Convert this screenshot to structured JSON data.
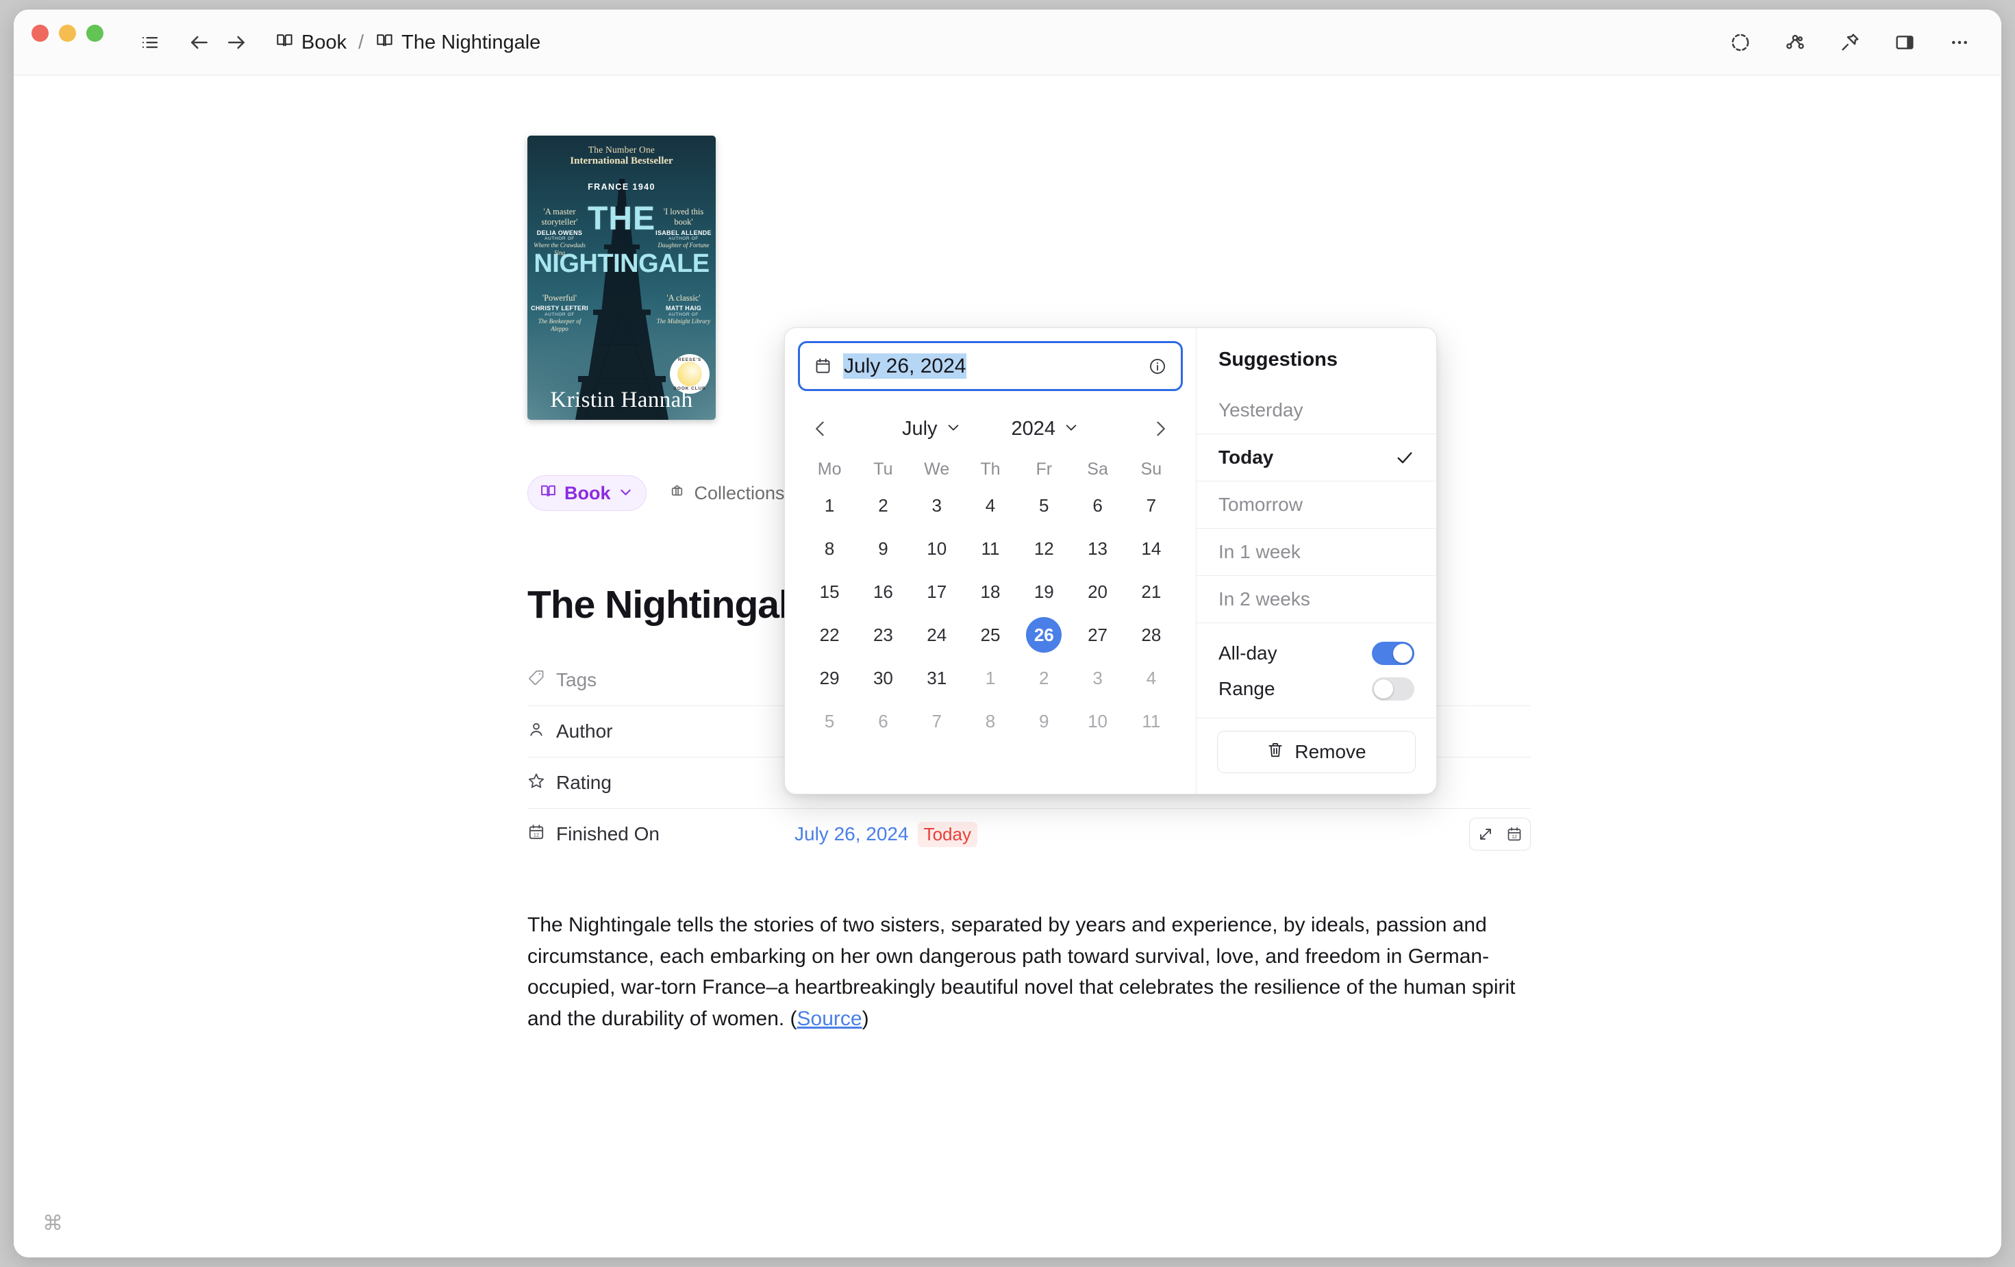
{
  "window": {
    "traffic_lights": [
      "close",
      "minimize",
      "maximize"
    ]
  },
  "toolbar": {
    "sidebar_toggle_icon": "list-icon",
    "back_icon": "arrow-left-icon",
    "forward_icon": "arrow-right-icon",
    "breadcrumb": {
      "parent_icon": "book-icon",
      "parent": "Book",
      "separator": "/",
      "current_icon": "book-icon",
      "current": "The Nightingale"
    },
    "right_actions": [
      {
        "name": "capture-icon",
        "label": ""
      },
      {
        "name": "graph-view-icon",
        "label": ""
      },
      {
        "name": "pin-icon",
        "label": ""
      },
      {
        "name": "panel-right-icon",
        "label": ""
      },
      {
        "name": "more-options-icon",
        "label": ""
      }
    ]
  },
  "cover": {
    "top_line_1": "The Number One",
    "top_line_2": "International Bestseller",
    "setting": "FRANCE 1940",
    "the": "THE",
    "title": "NIGHTINGALE",
    "author": "Kristin Hannah",
    "blurbs": [
      {
        "quote": "'A master storyteller'",
        "name": "DELIA OWENS",
        "author_of": "AUTHOR OF",
        "book": "Where the Crawdads Sing"
      },
      {
        "quote": "'I loved this book'",
        "name": "ISABEL ALLENDE",
        "author_of": "AUTHOR OF",
        "book": "Daughter of Fortune"
      },
      {
        "quote": "'Powerful'",
        "name": "CHRISTY LEFTERI",
        "author_of": "AUTHOR OF",
        "book": "The Beekeeper of Aleppo"
      },
      {
        "quote": "'A classic'",
        "name": "MATT HAIG",
        "author_of": "AUTHOR OF",
        "book": "The Midnight Library"
      }
    ],
    "badge_top": "REESE'S",
    "badge_bottom": "BOOK CLUB"
  },
  "page": {
    "type_chip": "Book",
    "collections_chip": "Collections",
    "title": "The Nightingale",
    "properties": [
      {
        "icon": "tag-icon",
        "label": "Tags",
        "muted": true,
        "value": ""
      },
      {
        "icon": "person-icon",
        "label": "Author",
        "muted": false,
        "value": ""
      },
      {
        "icon": "star-icon",
        "label": "Rating",
        "muted": false,
        "value": ""
      },
      {
        "icon": "calendar-icon",
        "label": "Finished On",
        "muted": false,
        "value": "July 26, 2024",
        "badge": "Today"
      }
    ],
    "row_actions": [
      {
        "name": "expand-icon"
      },
      {
        "name": "calendar-icon"
      }
    ],
    "body": {
      "text_before_link": "The Nightingale tells the stories of two sisters, separated by years and experience, by ideals, passion and circumstance, each embarking on her own dangerous path toward survival, love, and freedom in German-occupied, war-torn France–a heartbreakingly beautiful novel that celebrates the resilience of the human spirit and the durability of women. (",
      "link_text": "Source",
      "text_after_link": ")"
    },
    "command_key_glyph": "⌘"
  },
  "date_popover": {
    "input": {
      "icon": "calendar-icon",
      "value": "July 26, 2024",
      "selected": true,
      "info_icon": "info-icon"
    },
    "calendar": {
      "prev_icon": "chevron-left-icon",
      "next_icon": "chevron-right-icon",
      "month": "July",
      "year": "2024",
      "weekday_headers": [
        "Mo",
        "Tu",
        "We",
        "Th",
        "Fr",
        "Sa",
        "Su"
      ],
      "weeks": [
        [
          {
            "d": "1",
            "o": false
          },
          {
            "d": "2",
            "o": false
          },
          {
            "d": "3",
            "o": false
          },
          {
            "d": "4",
            "o": false
          },
          {
            "d": "5",
            "o": false
          },
          {
            "d": "6",
            "o": false
          },
          {
            "d": "7",
            "o": false
          }
        ],
        [
          {
            "d": "8",
            "o": false
          },
          {
            "d": "9",
            "o": false
          },
          {
            "d": "10",
            "o": false
          },
          {
            "d": "11",
            "o": false
          },
          {
            "d": "12",
            "o": false
          },
          {
            "d": "13",
            "o": false
          },
          {
            "d": "14",
            "o": false
          }
        ],
        [
          {
            "d": "15",
            "o": false
          },
          {
            "d": "16",
            "o": false
          },
          {
            "d": "17",
            "o": false
          },
          {
            "d": "18",
            "o": false
          },
          {
            "d": "19",
            "o": false
          },
          {
            "d": "20",
            "o": false
          },
          {
            "d": "21",
            "o": false
          }
        ],
        [
          {
            "d": "22",
            "o": false
          },
          {
            "d": "23",
            "o": false
          },
          {
            "d": "24",
            "o": false
          },
          {
            "d": "25",
            "o": false
          },
          {
            "d": "26",
            "o": false,
            "sel": true
          },
          {
            "d": "27",
            "o": false
          },
          {
            "d": "28",
            "o": false
          }
        ],
        [
          {
            "d": "29",
            "o": false
          },
          {
            "d": "30",
            "o": false
          },
          {
            "d": "31",
            "o": false
          },
          {
            "d": "1",
            "o": true
          },
          {
            "d": "2",
            "o": true
          },
          {
            "d": "3",
            "o": true
          },
          {
            "d": "4",
            "o": true
          }
        ],
        [
          {
            "d": "5",
            "o": true
          },
          {
            "d": "6",
            "o": true
          },
          {
            "d": "7",
            "o": true
          },
          {
            "d": "8",
            "o": true
          },
          {
            "d": "9",
            "o": true
          },
          {
            "d": "10",
            "o": true
          },
          {
            "d": "11",
            "o": true
          }
        ]
      ],
      "selected_day": "26"
    },
    "suggestions": {
      "title": "Suggestions",
      "items": [
        {
          "label": "Yesterday",
          "selected": false
        },
        {
          "label": "Today",
          "selected": true
        },
        {
          "label": "Tomorrow",
          "selected": false
        },
        {
          "label": "In 1 week",
          "selected": false
        },
        {
          "label": "In 2 weeks",
          "selected": false
        }
      ]
    },
    "toggles": [
      {
        "label": "All-day",
        "on": true
      },
      {
        "label": "Range",
        "on": false
      }
    ],
    "remove": {
      "icon": "trash-icon",
      "label": "Remove"
    }
  },
  "colors": {
    "accent_blue": "#4a7fe8",
    "focus_blue": "#2f6ae4",
    "selection_blue": "#b6d6f5",
    "today_red": "#e8413a",
    "book_purple": "#8b2ce0"
  }
}
